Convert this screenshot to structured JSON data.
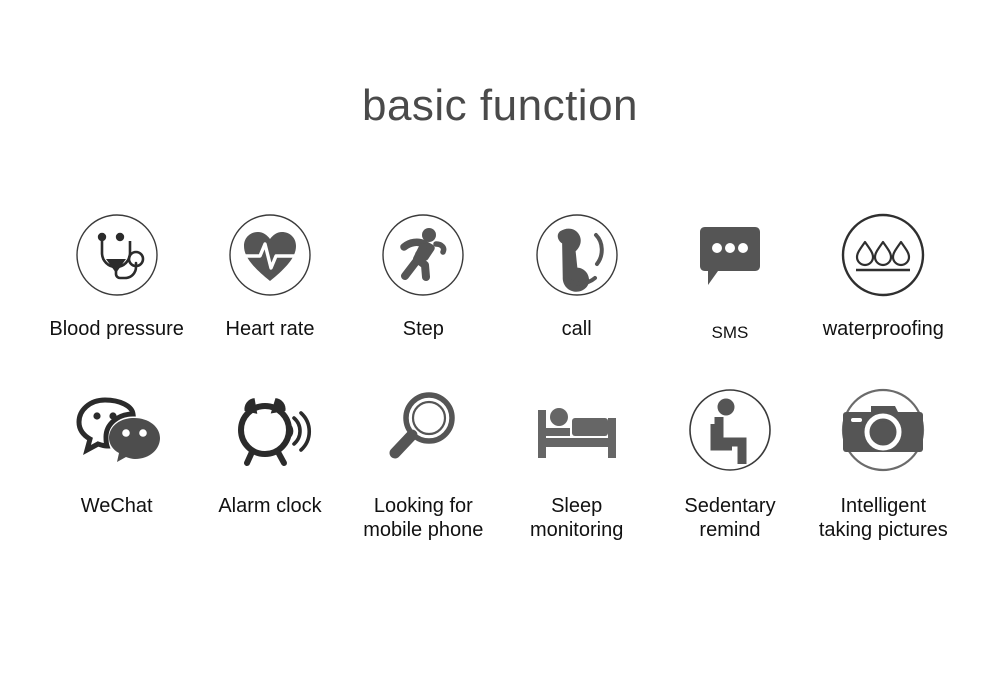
{
  "page": {
    "title": "basic function",
    "background_color": "#ffffff",
    "title_color": "#4a4a4a",
    "icon_color": "#555555",
    "icon_dark_color": "#2b2b2b",
    "label_color": "#111111"
  },
  "features": {
    "row1": [
      {
        "id": "blood-pressure",
        "label": "Blood pressure",
        "icon": "stethoscope-icon",
        "framed": true
      },
      {
        "id": "heart-rate",
        "label": "Heart rate",
        "icon": "heart-pulse-icon",
        "framed": true
      },
      {
        "id": "step",
        "label": "Step",
        "icon": "running-person-icon",
        "framed": true
      },
      {
        "id": "call",
        "label": "call",
        "icon": "phone-handset-icon",
        "framed": true
      },
      {
        "id": "sms",
        "label": "SMS",
        "icon": "speech-bubble-icon",
        "framed": false
      },
      {
        "id": "waterproofing",
        "label": "waterproofing",
        "icon": "water-droplets-icon",
        "framed": true
      }
    ],
    "row2": [
      {
        "id": "wechat",
        "label": "WeChat",
        "icon": "wechat-icon",
        "framed": false
      },
      {
        "id": "alarm-clock",
        "label": "Alarm clock",
        "icon": "alarm-clock-icon",
        "framed": false
      },
      {
        "id": "looking-for-mobile-phone",
        "label": "Looking for\nmobile phone",
        "icon": "magnifier-icon",
        "framed": false
      },
      {
        "id": "sleep-monitoring",
        "label": "Sleep\nmonitoring",
        "icon": "bed-sleep-icon",
        "framed": false
      },
      {
        "id": "sedentary-remind",
        "label": "Sedentary\nremind",
        "icon": "sitting-person-icon",
        "framed": true
      },
      {
        "id": "intelligent-taking-pictures",
        "label": "Intelligent\ntaking pictures",
        "icon": "camera-icon",
        "framed": true
      }
    ]
  }
}
